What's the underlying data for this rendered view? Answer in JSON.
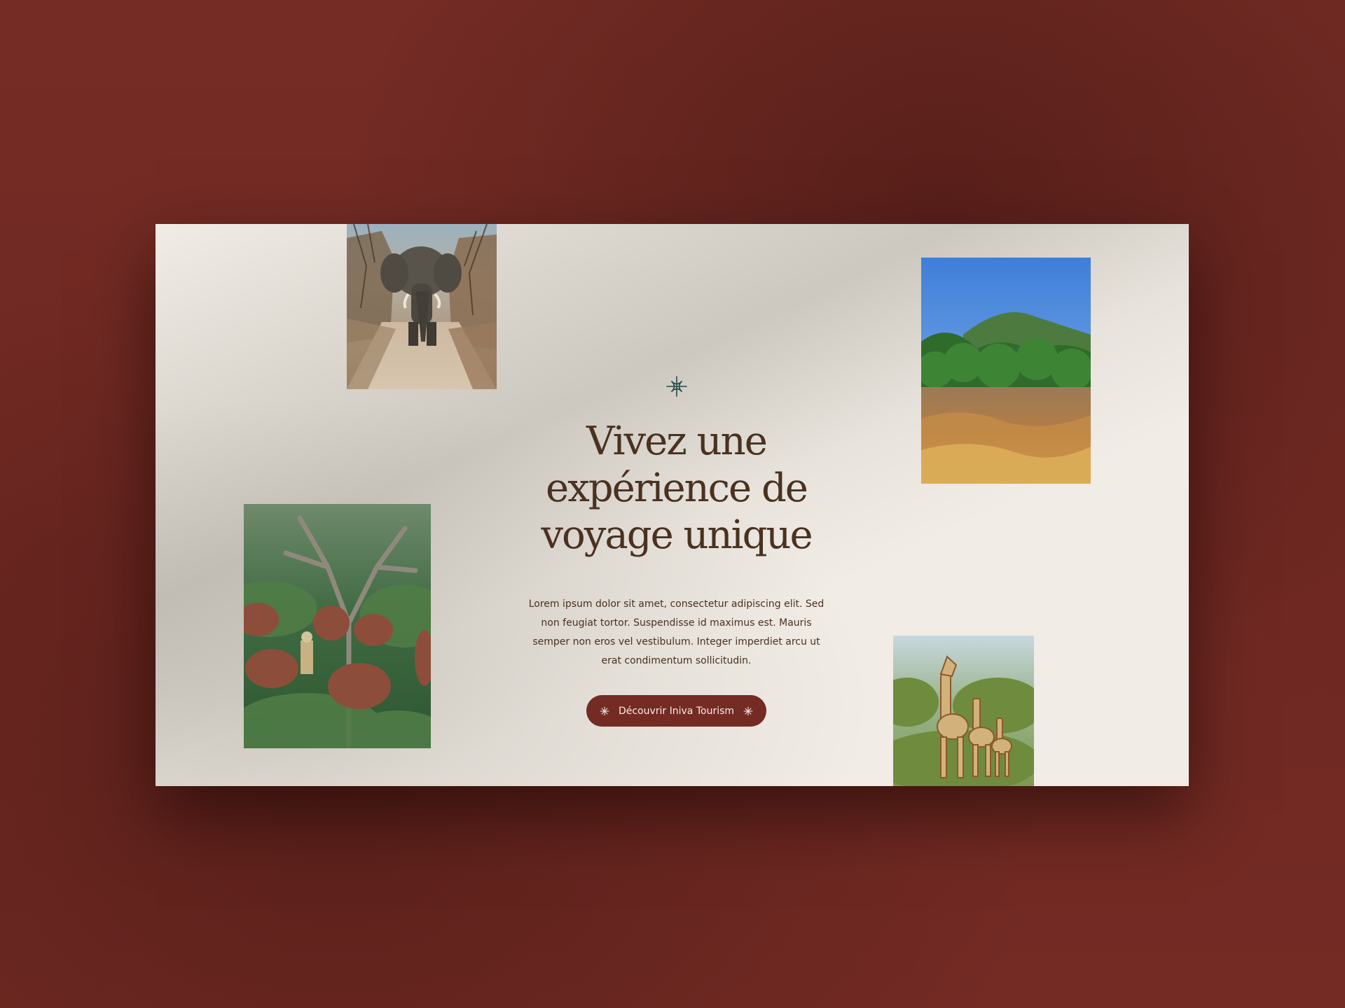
{
  "hero": {
    "headline": "Vivez une\nexpérience de\nvoyage unique",
    "description": "Lorem ipsum dolor sit amet, consectetur adipiscing elit. Sed non feugiat tortor. Suspendisse id maximus est. Mauris semper non eros vel vestibulum. Integer imperdiet arcu ut erat condimentum sollicitudin.",
    "cta_label": "Découvrir Iniva Tourism"
  },
  "icons": {
    "ornament": "compass-star-icon",
    "cta_left": "sparkle-icon",
    "cta_right": "sparkle-icon"
  },
  "colors": {
    "background": "#742b24",
    "surface": "#f1ece5",
    "text": "#4a3120",
    "button": "#742b24",
    "button_text": "#f6ede3",
    "ornament": "#244a4a"
  }
}
